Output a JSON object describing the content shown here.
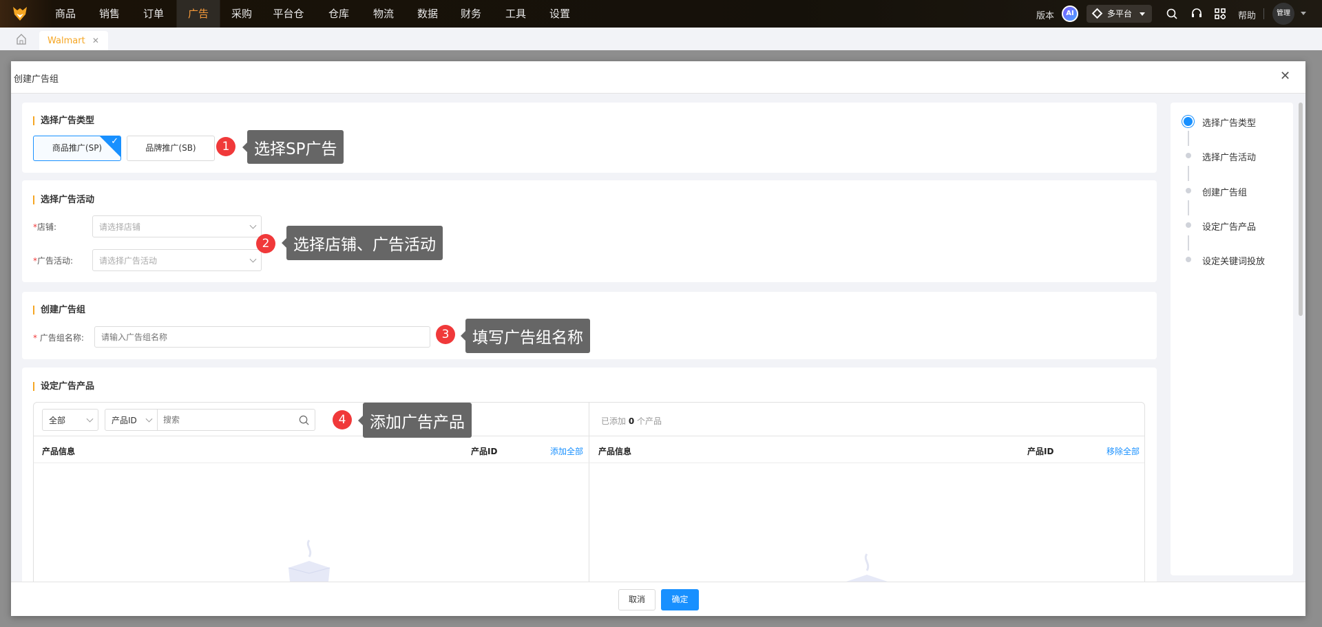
{
  "topnav": {
    "items": [
      "商品",
      "销售",
      "订单",
      "广告",
      "采购",
      "平台仓",
      "仓库",
      "物流",
      "数据",
      "财务",
      "工具",
      "设置"
    ],
    "active": "广告",
    "version": "版本",
    "ai": "AI",
    "platform": "多平台",
    "help": "帮助",
    "user": "管理"
  },
  "tabs": {
    "items": [
      {
        "label": "Walmart"
      }
    ]
  },
  "modal": {
    "title": "创建广告组",
    "type_section": {
      "title": "选择广告类型",
      "options": [
        "商品推广(SP)",
        "品牌推广(SB)"
      ],
      "selected": "商品推广(SP)"
    },
    "campaign_section": {
      "title": "选择广告活动",
      "store_label": "店铺:",
      "store_placeholder": "请选择店铺",
      "campaign_label": "广告活动:",
      "campaign_placeholder": "请选择广告活动"
    },
    "group_section": {
      "title": "创建广告组",
      "name_label": "广告组名称:",
      "name_placeholder": "请输入广告组名称"
    },
    "product_section": {
      "title": "设定广告产品",
      "filter_all": "全部",
      "filter_field": "产品ID",
      "search_placeholder": "搜索",
      "left_headers": [
        "产品信息",
        "产品ID"
      ],
      "add_all": "添加全部",
      "added_prefix": "已添加",
      "added_count": "0",
      "added_suffix": "个产品",
      "right_headers": [
        "产品信息",
        "产品ID"
      ],
      "remove_all": "移除全部"
    },
    "steps": [
      "选择广告类型",
      "选择广告活动",
      "创建广告组",
      "设定广告产品",
      "设定关键词投放"
    ],
    "active_step": 0,
    "cancel": "取消",
    "confirm": "确定"
  },
  "annotations": [
    {
      "n": "1",
      "text": "选择SP广告"
    },
    {
      "n": "2",
      "text": "选择店铺、广告活动"
    },
    {
      "n": "3",
      "text": "填写广告组名称"
    },
    {
      "n": "4",
      "text": "添加广告产品"
    }
  ],
  "colors": {
    "accent": "#1890ff",
    "brand": "#f79a3a",
    "badge": "#f0393a"
  }
}
